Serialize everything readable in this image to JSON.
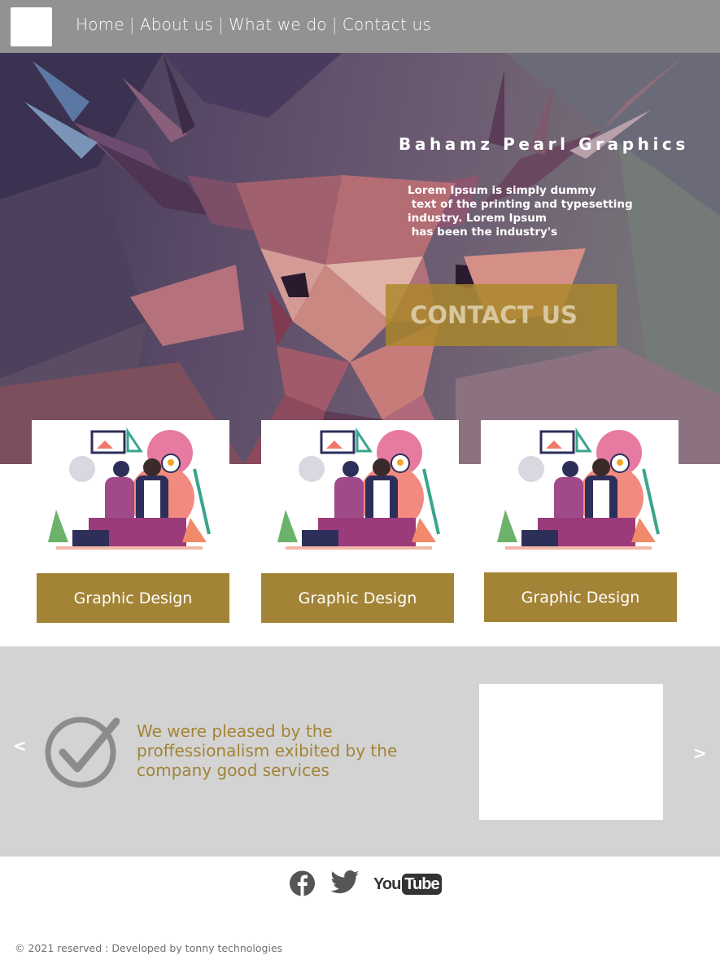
{
  "nav": {
    "menu": [
      "Home",
      "About us",
      "What we do",
      "Contact us"
    ],
    "separator": "|"
  },
  "hero": {
    "title": "Bahamz Pearl Graphics",
    "text": "Lorem Ipsum is simply dummy\n text of the printing and typesetting\nindustry. Lorem Ipsum\n has been the industry's",
    "cta": "CONTACT US"
  },
  "cards": [
    {
      "label": "Graphic Design"
    },
    {
      "label": "Graphic Design"
    },
    {
      "label": "Graphic Design"
    }
  ],
  "testimonial": {
    "prev": "<",
    "next": ">",
    "quote": "We were pleased by the proffessionalism exibited by the company good services"
  },
  "footer": {
    "social_icons": [
      "facebook-icon",
      "twitter-icon",
      "youtube-icon"
    ],
    "youtube_you": "You",
    "youtube_tube": "Tube",
    "copyright": "© 2021 reserved : Developed by tonny technologies"
  },
  "colors": {
    "nav_bg": "#929292",
    "accent": "#a38436",
    "testimonial_bg": "#d3d3d3"
  }
}
